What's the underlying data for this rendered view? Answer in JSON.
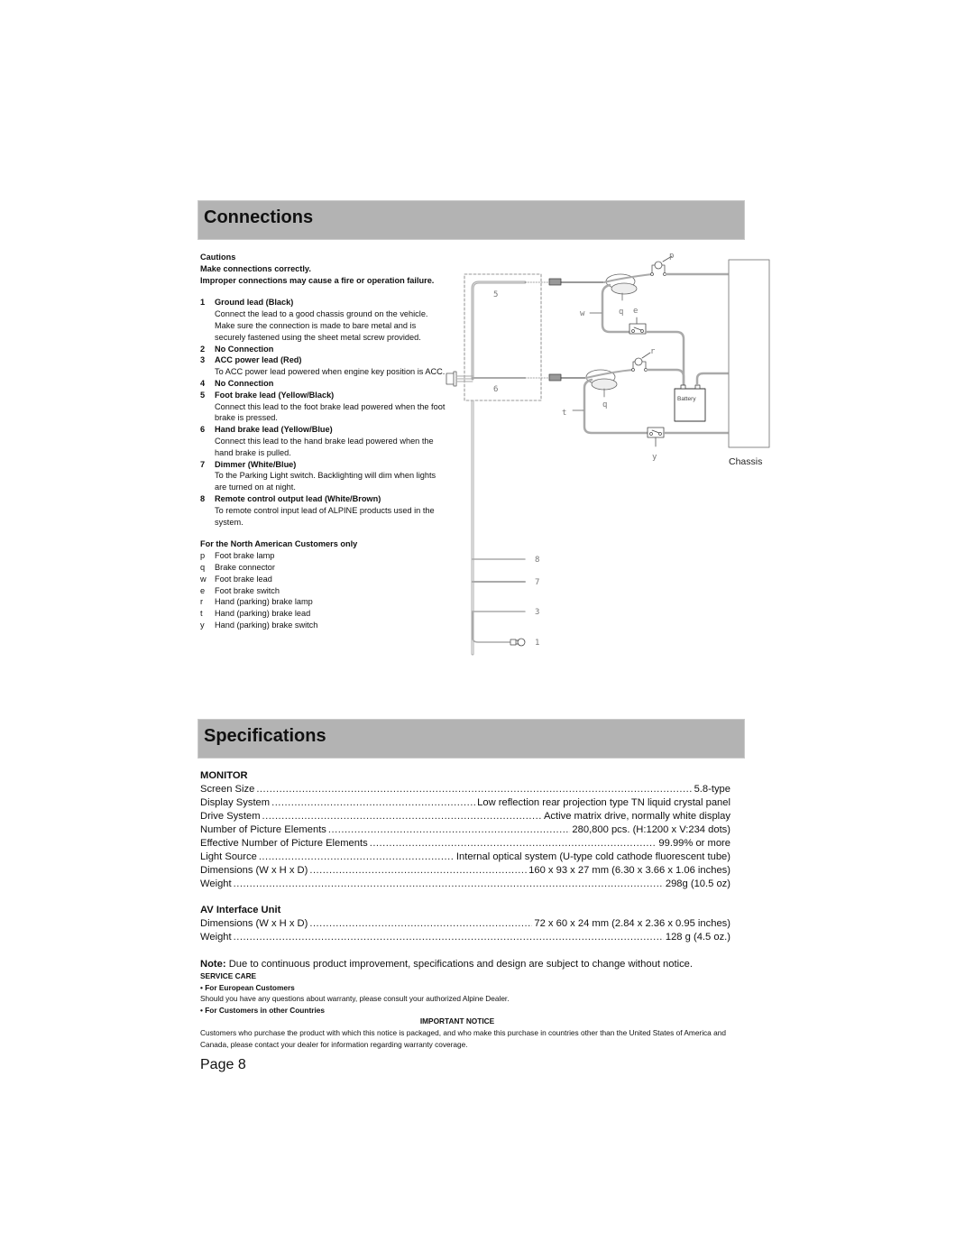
{
  "connections": {
    "title": "Connections",
    "cautions": {
      "heading": "Cautions",
      "line1": "Make connections correctly.",
      "line2": "Improper connections may cause a fire or operation failure."
    },
    "leads": [
      {
        "num": "1",
        "title": "Ground lead (Black)",
        "desc": "Connect the lead to a good chassis ground on the vehicle. Make sure the connection is made to bare metal and is securely fastened using the sheet metal screw provided."
      },
      {
        "num": "2",
        "title": "No Connection",
        "desc": ""
      },
      {
        "num": "3",
        "title": "ACC power lead (Red)",
        "desc": "To ACC power lead powered when engine key position is ACC."
      },
      {
        "num": "4",
        "title": "No Connection",
        "desc": ""
      },
      {
        "num": "5",
        "title": "Foot brake lead (Yellow/Black)",
        "desc": "Connect this lead to the foot brake lead powered when the foot brake is pressed."
      },
      {
        "num": "6",
        "title": "Hand brake lead (Yellow/Blue)",
        "desc": "Connect this lead to the hand brake lead powered when the hand brake is pulled."
      },
      {
        "num": "7",
        "title": "Dimmer (White/Blue)",
        "desc": "To the Parking Light switch. Backlighting will dim when lights are turned on at night."
      },
      {
        "num": "8",
        "title": "Remote control output lead (White/Brown)",
        "desc": "To remote control input lead of ALPINE products used in the system."
      }
    ],
    "north_american": {
      "heading": "For the North American Customers only",
      "items": [
        {
          "key": "p",
          "label": "Foot brake lamp"
        },
        {
          "key": "q",
          "label": "Brake connector"
        },
        {
          "key": "w",
          "label": "Foot brake lead"
        },
        {
          "key": "e",
          "label": "Foot brake switch"
        },
        {
          "key": "r",
          "label": "Hand (parking) brake lamp"
        },
        {
          "key": "t",
          "label": "Hand (parking) brake lead"
        },
        {
          "key": "y",
          "label": "Hand (parking) brake switch"
        }
      ]
    },
    "diagram": {
      "labels": {
        "p": "p",
        "q_top": "q",
        "w": "w",
        "e": "e",
        "r": "r",
        "q_bottom": "q",
        "t": "t",
        "y": "y",
        "lead5": "5",
        "lead6": "6",
        "lead8": "8",
        "lead7": "7",
        "lead3": "3",
        "lead1": "1"
      },
      "battery": "Battery",
      "chassis": "Chassis"
    }
  },
  "specifications": {
    "title": "Specifications",
    "monitor": {
      "heading": "MONITOR",
      "rows": [
        {
          "label": "Screen Size",
          "value": "5.8-type"
        },
        {
          "label": "Display System",
          "value": "Low reflection rear projection type TN liquid crystal panel"
        },
        {
          "label": "Drive System",
          "value": "Active matrix drive, normally white display"
        },
        {
          "label": "Number of Picture Elements",
          "value": "280,800 pcs. (H:1200 x V:234 dots)"
        },
        {
          "label": "Effective Number of Picture Elements",
          "value": "99.99% or more"
        },
        {
          "label": "Light Source",
          "value": "Internal optical system (U-type cold cathode fluorescent tube)"
        },
        {
          "label": "Dimensions (W x H x D)",
          "value": "160 x 93 x 27 mm (6.30 x 3.66 x 1.06 inches)"
        },
        {
          "label": "Weight",
          "value": "298g (10.5 oz)"
        }
      ]
    },
    "av_unit": {
      "heading": "AV Interface Unit",
      "rows": [
        {
          "label": "Dimensions (W x H x D)",
          "value": "72 x 60 x 24 mm (2.84 x 2.36 x 0.95 inches)"
        },
        {
          "label": "Weight",
          "value": "128 g (4.5 oz.)"
        }
      ]
    },
    "note_label": "Note:",
    "note_text": " Due to continuous product improvement, specifications and design are subject to change without notice."
  },
  "service_care": {
    "heading": "SERVICE CARE",
    "european_heading": "• For European Customers",
    "european_text": "Should you have any questions about warranty, please consult your authorized Alpine Dealer.",
    "other_heading": "• For Customers in other Countries",
    "notice_heading": "IMPORTANT NOTICE",
    "notice_text": "Customers who purchase the product with which this notice is packaged, and who make this purchase in countries other than the United States of America and Canada, please contact your dealer for information regarding warranty coverage."
  },
  "page": {
    "label": "Page 8"
  }
}
